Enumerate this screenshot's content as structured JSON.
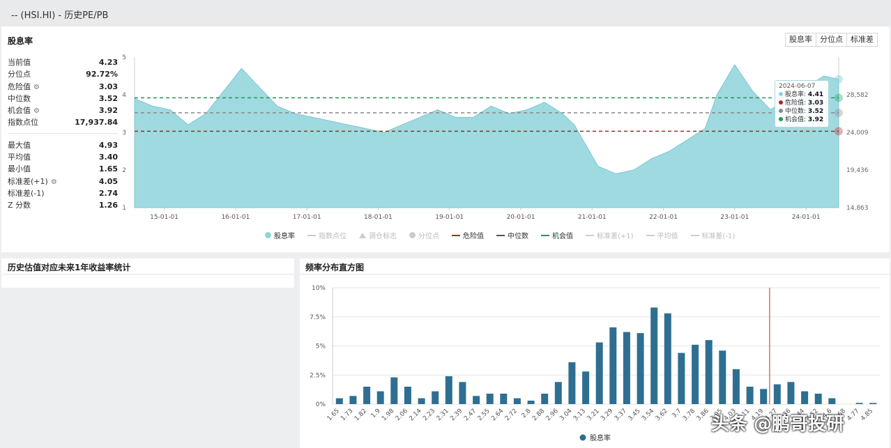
{
  "window_title": "-- (HSI.HI) - 历史PE/PB",
  "main_panel": {
    "title": "股息率",
    "stats_top": [
      {
        "label": "当前值",
        "value": "4.23",
        "gear": false
      },
      {
        "label": "分位点",
        "value": "92.72%",
        "gear": false
      },
      {
        "label": "危险值",
        "value": "3.03",
        "gear": true
      },
      {
        "label": "中位数",
        "value": "3.52",
        "gear": false
      },
      {
        "label": "机会值",
        "value": "3.92",
        "gear": true
      },
      {
        "label": "指数点位",
        "value": "17,937.84",
        "gear": false
      }
    ],
    "stats_bottom": [
      {
        "label": "最大值",
        "value": "4.93",
        "gear": false
      },
      {
        "label": "平均值",
        "value": "3.40",
        "gear": false
      },
      {
        "label": "最小值",
        "value": "1.65",
        "gear": false
      },
      {
        "label": "标准差(+1)",
        "value": "4.05",
        "gear": true
      },
      {
        "label": "标准差(-1)",
        "value": "2.74",
        "gear": false
      },
      {
        "label": "Z 分数",
        "value": "1.26",
        "gear": false
      }
    ],
    "buttons": [
      "股息率",
      "分位点",
      "标准差"
    ],
    "tooltip": {
      "date": "2024-06-07",
      "rows": [
        {
          "label": "股息率:",
          "value": "4.41",
          "color": "#8fd3dc"
        },
        {
          "label": "危险值:",
          "value": "3.03",
          "color": "#b22222"
        },
        {
          "label": "中位数:",
          "value": "3.52",
          "color": "#888888"
        },
        {
          "label": "机会值:",
          "value": "3.92",
          "color": "#1a9a55"
        }
      ]
    },
    "legend": [
      {
        "label": "股息率",
        "kind": "dot",
        "color": "#8fd3dc",
        "active": true
      },
      {
        "label": "指数点位",
        "kind": "line",
        "color": "#cccccc",
        "active": false
      },
      {
        "label": "调仓标志",
        "kind": "tri",
        "color": "#cccccc",
        "active": false
      },
      {
        "label": "分位点",
        "kind": "dot",
        "color": "#cccccc",
        "active": false
      },
      {
        "label": "危险值",
        "kind": "dash",
        "color": "#b22222",
        "active": true
      },
      {
        "label": "中位数",
        "kind": "dash",
        "color": "#555555",
        "active": true
      },
      {
        "label": "机会值",
        "kind": "dash",
        "color": "#1a9a55",
        "active": true
      },
      {
        "label": "标准差(+1)",
        "kind": "dash",
        "color": "#cccccc",
        "active": false
      },
      {
        "label": "平均值",
        "kind": "dash",
        "color": "#cccccc",
        "active": false
      },
      {
        "label": "标准差(-1)",
        "kind": "dash",
        "color": "#cccccc",
        "active": false
      }
    ]
  },
  "stats_panel": {
    "title": "历史估值对应未来1年收益率统计"
  },
  "hist_panel": {
    "title": "频率分布直方图"
  },
  "watermark": "头条 @鹏哥投研",
  "chart_data": [
    {
      "type": "area",
      "title": "股息率",
      "x_ticks": [
        "15-01-01",
        "16-01-01",
        "17-01-01",
        "18-01-01",
        "19-01-01",
        "20-01-01",
        "21-01-01",
        "22-01-01",
        "23-01-01",
        "24-01-01"
      ],
      "ylim": [
        1,
        5
      ],
      "y_ticks": [
        "1",
        "2",
        "3",
        "4",
        "5"
      ],
      "y2_ticks": [
        "14,863",
        "19,436",
        "24,009",
        "28,582"
      ],
      "series": [
        {
          "name": "股息率",
          "color": "#8fd3dc",
          "x": [
            "2014-08",
            "2014-11",
            "2015-02",
            "2015-05",
            "2015-08",
            "2015-11",
            "2016-02",
            "2016-05",
            "2016-08",
            "2016-11",
            "2017-02",
            "2017-05",
            "2017-08",
            "2017-11",
            "2018-02",
            "2018-05",
            "2018-08",
            "2018-11",
            "2019-02",
            "2019-05",
            "2019-08",
            "2019-11",
            "2020-02",
            "2020-05",
            "2020-08",
            "2020-10",
            "2021-02",
            "2021-05",
            "2021-08",
            "2021-11",
            "2022-02",
            "2022-05",
            "2022-08",
            "2022-10",
            "2023-01",
            "2023-04",
            "2023-07",
            "2023-10",
            "2024-01",
            "2024-04",
            "2024-06"
          ],
          "values": [
            3.9,
            3.7,
            3.6,
            3.2,
            3.5,
            4.1,
            4.7,
            4.2,
            3.7,
            3.5,
            3.4,
            3.3,
            3.2,
            3.1,
            3.0,
            3.2,
            3.4,
            3.6,
            3.4,
            3.4,
            3.7,
            3.5,
            3.6,
            3.8,
            3.5,
            3.2,
            2.1,
            1.9,
            2.0,
            2.3,
            2.5,
            2.8,
            3.1,
            4.0,
            4.8,
            4.1,
            3.6,
            3.9,
            4.2,
            4.5,
            4.41
          ]
        },
        {
          "name": "危险值",
          "color": "#b22222",
          "value": 3.03
        },
        {
          "name": "中位数",
          "color": "#888888",
          "value": 3.52
        },
        {
          "name": "机会值",
          "color": "#1a9a55",
          "value": 3.92
        }
      ]
    },
    {
      "type": "bar",
      "title": "频率分布直方图",
      "categories": [
        "1.65",
        "1.73",
        "1.82",
        "1.9",
        "1.98",
        "2.06",
        "2.14",
        "2.23",
        "2.31",
        "2.39",
        "2.47",
        "2.55",
        "2.64",
        "2.72",
        "2.8",
        "2.88",
        "2.96",
        "3.04",
        "3.13",
        "3.21",
        "3.29",
        "3.37",
        "3.45",
        "3.54",
        "3.62",
        "3.7",
        "3.78",
        "3.86",
        "3.95",
        "4.03",
        "4.11",
        "4.19",
        "4.27",
        "4.36",
        "4.44",
        "4.52",
        "4.6",
        "4.68",
        "4.77",
        "4.85"
      ],
      "series": [
        {
          "name": "股息率",
          "color": "#2e6f91",
          "values": [
            0.5,
            0.7,
            1.5,
            1.1,
            2.3,
            1.5,
            0.5,
            1.1,
            2.4,
            1.9,
            0.7,
            0.9,
            0.9,
            0.5,
            0.3,
            0.9,
            1.9,
            3.6,
            2.8,
            5.3,
            6.6,
            6.2,
            6.1,
            8.3,
            7.8,
            4.4,
            5.1,
            5.5,
            4.6,
            3.0,
            1.5,
            1.3,
            1.7,
            1.9,
            1.1,
            0.9,
            0.5,
            0.0,
            0.1,
            0.1
          ]
        }
      ],
      "y_ticks": [
        "0%",
        "2.5%",
        "5%",
        "7.5%",
        "10%"
      ],
      "ylim": [
        0,
        10
      ],
      "marker_value": "4.23"
    }
  ]
}
